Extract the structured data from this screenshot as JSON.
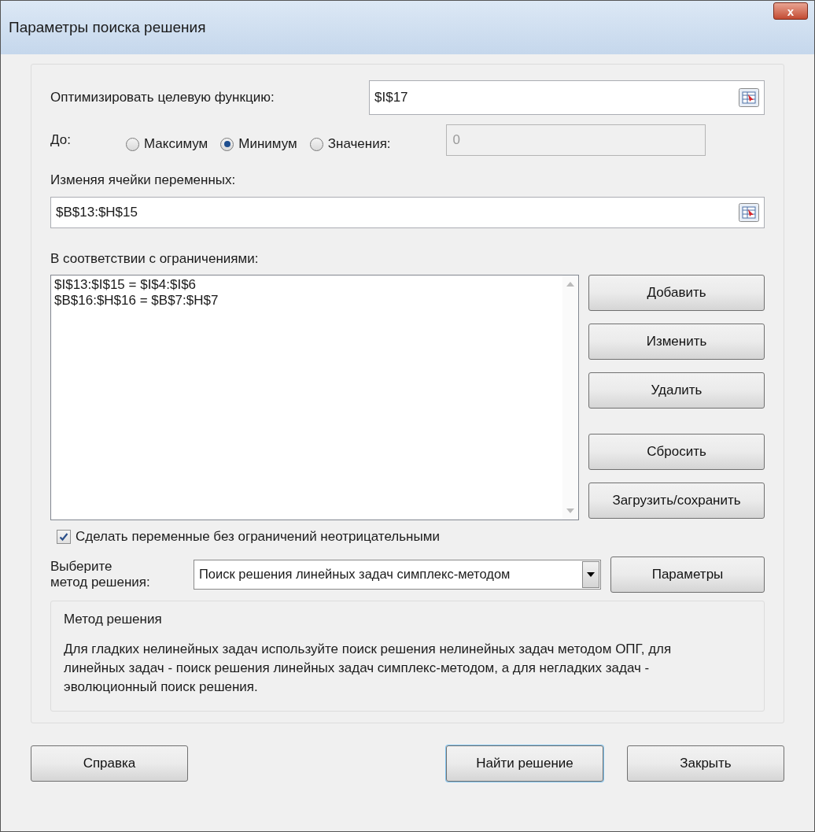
{
  "window": {
    "title": "Параметры поиска решения",
    "close": "x"
  },
  "objective": {
    "label": "Оптимизировать целевую функцию:",
    "value": "$I$17"
  },
  "to": {
    "label": "До:",
    "options": [
      {
        "label": "Максимум",
        "selected": false
      },
      {
        "label": "Минимум",
        "selected": true
      },
      {
        "label": "Значения:",
        "selected": false
      }
    ],
    "value_field": {
      "value": "0",
      "disabled": true
    }
  },
  "variables": {
    "label": "Изменяя ячейки переменных:",
    "value": "$B$13:$H$15"
  },
  "constraints": {
    "label": "В соответствии с ограничениями:",
    "items": [
      "$I$13:$I$15 = $I$4:$I$6",
      "$B$16:$H$16 = $B$7:$H$7"
    ],
    "button_groups": [
      [
        "Добавить",
        "Изменить",
        "Удалить"
      ],
      [
        "Сбросить",
        "Загрузить/сохранить"
      ]
    ]
  },
  "nonnegative": {
    "label": "Сделать переменные без ограничений неотрицательными",
    "checked": true
  },
  "method": {
    "label_lines": [
      "Выберите",
      "метод решения:"
    ],
    "value": "Поиск решения линейных задач симплекс-методом",
    "button": "Параметры"
  },
  "method_info": {
    "title": "Метод решения",
    "text": "Для гладких нелинейных задач используйте поиск решения нелинейных задач методом ОПГ, для линейных задач - поиск решения линейных задач симплекс-методом, а для негладких задач - эволюционный поиск решения."
  },
  "footer_buttons": [
    {
      "label": "Справка",
      "default": false,
      "kind": "left"
    },
    {
      "label": "Найти решение",
      "default": true,
      "kind": "right"
    },
    {
      "label": "Закрыть",
      "default": false,
      "kind": "right"
    }
  ]
}
